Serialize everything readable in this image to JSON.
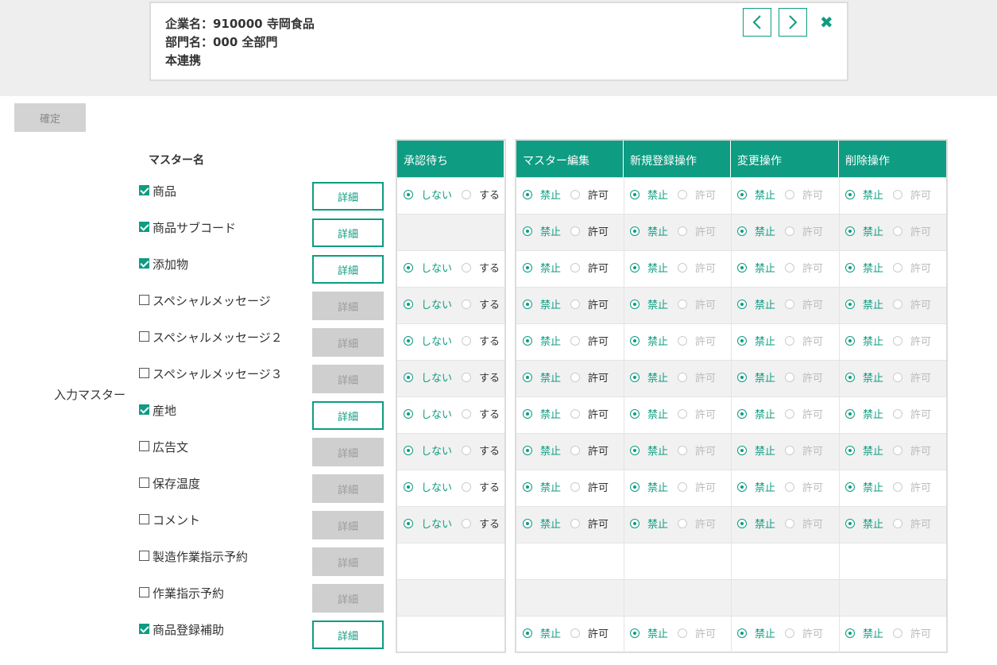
{
  "header": {
    "company": "企業名：910000 寺岡食品",
    "department": "部門名：000 全部門",
    "subtitle": "本連携"
  },
  "toolbar": {
    "confirm_label": "確定"
  },
  "group_label": "入力マスター",
  "master_header": "マスター名",
  "columns": {
    "approval": "承認待ち",
    "perms": [
      "マスター編集",
      "新規登録操作",
      "変更操作",
      "削除操作"
    ]
  },
  "options": {
    "approval_off": "しない",
    "approval_on": "する",
    "forbid": "禁止",
    "allow": "許可"
  },
  "detail_label": "詳細",
  "masters": [
    {
      "name": "商品",
      "checked": true,
      "approval": true,
      "perms": true
    },
    {
      "name": "商品サブコード",
      "checked": true,
      "approval": false,
      "perms": true
    },
    {
      "name": "添加物",
      "checked": true,
      "approval": true,
      "perms": true
    },
    {
      "name": "スペシャルメッセージ",
      "checked": false,
      "approval": true,
      "perms": true
    },
    {
      "name": "スペシャルメッセージ２",
      "checked": false,
      "approval": true,
      "perms": true
    },
    {
      "name": "スペシャルメッセージ３",
      "checked": false,
      "approval": true,
      "perms": true
    },
    {
      "name": "産地",
      "checked": true,
      "approval": true,
      "perms": true
    },
    {
      "name": "広告文",
      "checked": false,
      "approval": true,
      "perms": true
    },
    {
      "name": "保存温度",
      "checked": false,
      "approval": true,
      "perms": true
    },
    {
      "name": "コメント",
      "checked": false,
      "approval": true,
      "perms": true
    },
    {
      "name": "製造作業指示予約",
      "checked": false,
      "approval": false,
      "perms": false
    },
    {
      "name": "作業指示予約",
      "checked": false,
      "approval": false,
      "perms": false
    },
    {
      "name": "商品登録補助",
      "checked": true,
      "approval": false,
      "perms": true
    }
  ]
}
